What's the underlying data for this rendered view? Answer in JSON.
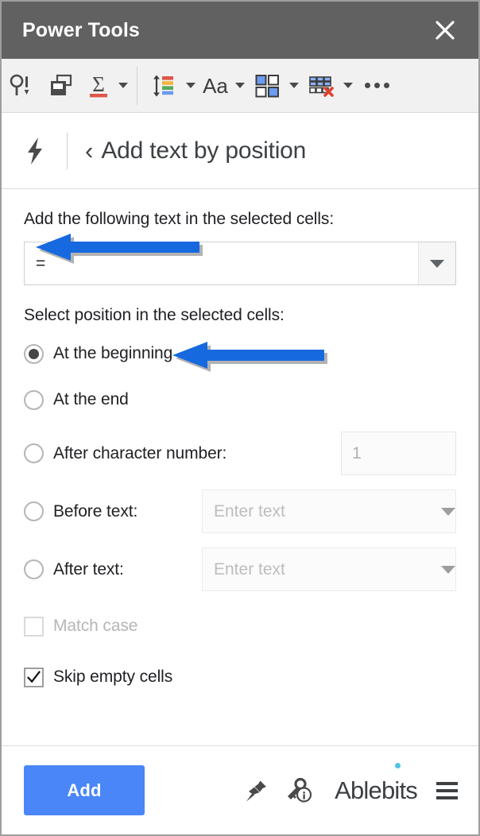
{
  "window": {
    "title": "Power Tools",
    "close_label": "✕"
  },
  "toolbar": {
    "items": [
      {
        "name": "find-replace-tool",
        "icon": "magnifier-exclamation-icon",
        "has_caret": false
      },
      {
        "name": "merge-tool",
        "icon": "merge-sheets-icon",
        "has_caret": false
      },
      {
        "name": "formulas-tool",
        "icon": "sigma-sum-icon",
        "has_caret": true
      },
      {
        "name": "sort-randomize-tool",
        "icon": "sort-colors-icon",
        "has_caret": true
      },
      {
        "name": "text-tool",
        "icon": "text-Aa-icon",
        "has_caret": true
      },
      {
        "name": "split-tool",
        "icon": "four-squares-icon",
        "has_caret": true
      },
      {
        "name": "clear-tool",
        "icon": "table-clear-icon",
        "has_caret": true
      },
      {
        "name": "more-tools",
        "icon": "ellipsis-icon",
        "has_caret": false
      }
    ],
    "more_label": "•••"
  },
  "tool_header": {
    "icon": "lightning-bolt-icon",
    "back_label": "‹",
    "title": "Add text by position"
  },
  "form": {
    "text_field_label": "Add the following text in the selected cells:",
    "text_field_value": "=",
    "text_field_placeholder": "",
    "position_label": "Select position in the selected cells:",
    "options": [
      {
        "id": "at-beginning",
        "label": "At the beginning",
        "checked": true
      },
      {
        "id": "at-end",
        "label": "At the end",
        "checked": false
      },
      {
        "id": "after-character-number",
        "label": "After character number:",
        "checked": false
      },
      {
        "id": "before-text",
        "label": "Before text:",
        "checked": false
      },
      {
        "id": "after-text",
        "label": "After text:",
        "checked": false
      }
    ],
    "char_number_value": "1",
    "char_number_placeholder": "1",
    "before_text_value": "",
    "before_text_placeholder": "Enter text",
    "after_text_value": "",
    "after_text_placeholder": "Enter text",
    "match_case": {
      "label": "Match case",
      "checked": false,
      "disabled": true
    },
    "skip_empty_cells": {
      "label": "Skip empty cells",
      "checked": true,
      "disabled": false
    }
  },
  "footer": {
    "primary_button": "Add",
    "pin_icon": "pushpin-icon",
    "info_icon": "key-info-icon",
    "brand_part1": "Able",
    "brand_part2": "b",
    "brand_part3": "its",
    "brand_full": "Ablebits",
    "menu_icon": "hamburger-menu-icon"
  },
  "annotations": [
    {
      "name": "arrow-to-text-field",
      "color": "#1769E0"
    },
    {
      "name": "arrow-to-at-the-beginning",
      "color": "#1769E0"
    }
  ],
  "colors": {
    "titlebar_bg": "#616161",
    "toolbar_bg": "#f1f1f1",
    "primary_button": "#4a86f7",
    "annotation_blue": "#1769E0",
    "brand_accent": "#4fc3e8",
    "text": "#202124"
  }
}
